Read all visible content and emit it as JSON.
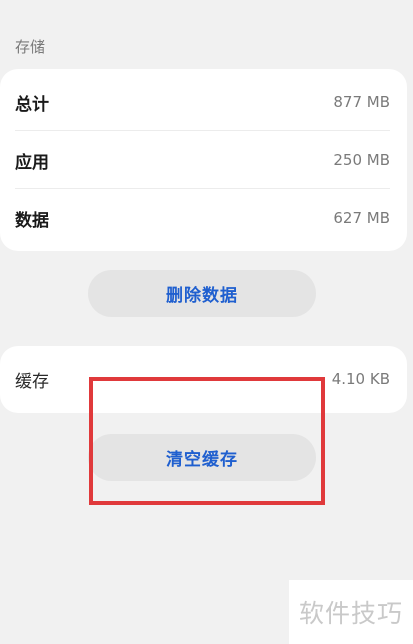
{
  "storage": {
    "section_label": "存储",
    "rows": [
      {
        "label": "总计",
        "value": "877 MB"
      },
      {
        "label": "应用",
        "value": "250 MB"
      },
      {
        "label": "数据",
        "value": "627 MB"
      }
    ],
    "delete_button_label": "删除数据"
  },
  "cache": {
    "label": "缓存",
    "value": "4.10 KB",
    "clear_button_label": "清空缓存"
  },
  "annotation": {
    "highlight_color": "#e0393b"
  },
  "watermark": {
    "text": "软件技巧"
  },
  "colors": {
    "accent": "#1f5fcf",
    "background": "#f1f1f1",
    "card": "#ffffff",
    "button": "#e4e4e4"
  }
}
